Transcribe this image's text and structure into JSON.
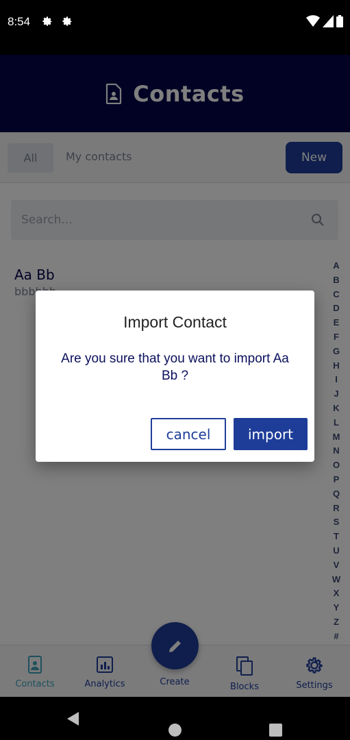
{
  "status_bar": {
    "time": "8:54"
  },
  "header": {
    "title": "Contacts",
    "icon": "contact-card-icon"
  },
  "tabs": {
    "all_label": "All",
    "mine_label": "My contacts",
    "new_label": "New"
  },
  "search": {
    "placeholder": "Search..."
  },
  "contacts": [
    {
      "name": "Aa Bb",
      "subtitle": "bbbbbb"
    }
  ],
  "alphabet": [
    "A",
    "B",
    "C",
    "D",
    "E",
    "F",
    "G",
    "H",
    "I",
    "J",
    "K",
    "L",
    "M",
    "N",
    "O",
    "P",
    "Q",
    "R",
    "S",
    "T",
    "U",
    "V",
    "W",
    "X",
    "Y",
    "Z",
    "#"
  ],
  "bottom_nav": {
    "contacts": "Contacts",
    "analytics": "Analytics",
    "create": "Create",
    "blocks": "Blocks",
    "settings": "Settings"
  },
  "dialog": {
    "title": "Import Contact",
    "message": "Are you sure that you want to import Aa Bb ?",
    "cancel_label": "cancel",
    "import_label": "import"
  },
  "colors": {
    "header": "#030449",
    "primary": "#1e3d99",
    "active_nav": "#3aa2b8"
  }
}
